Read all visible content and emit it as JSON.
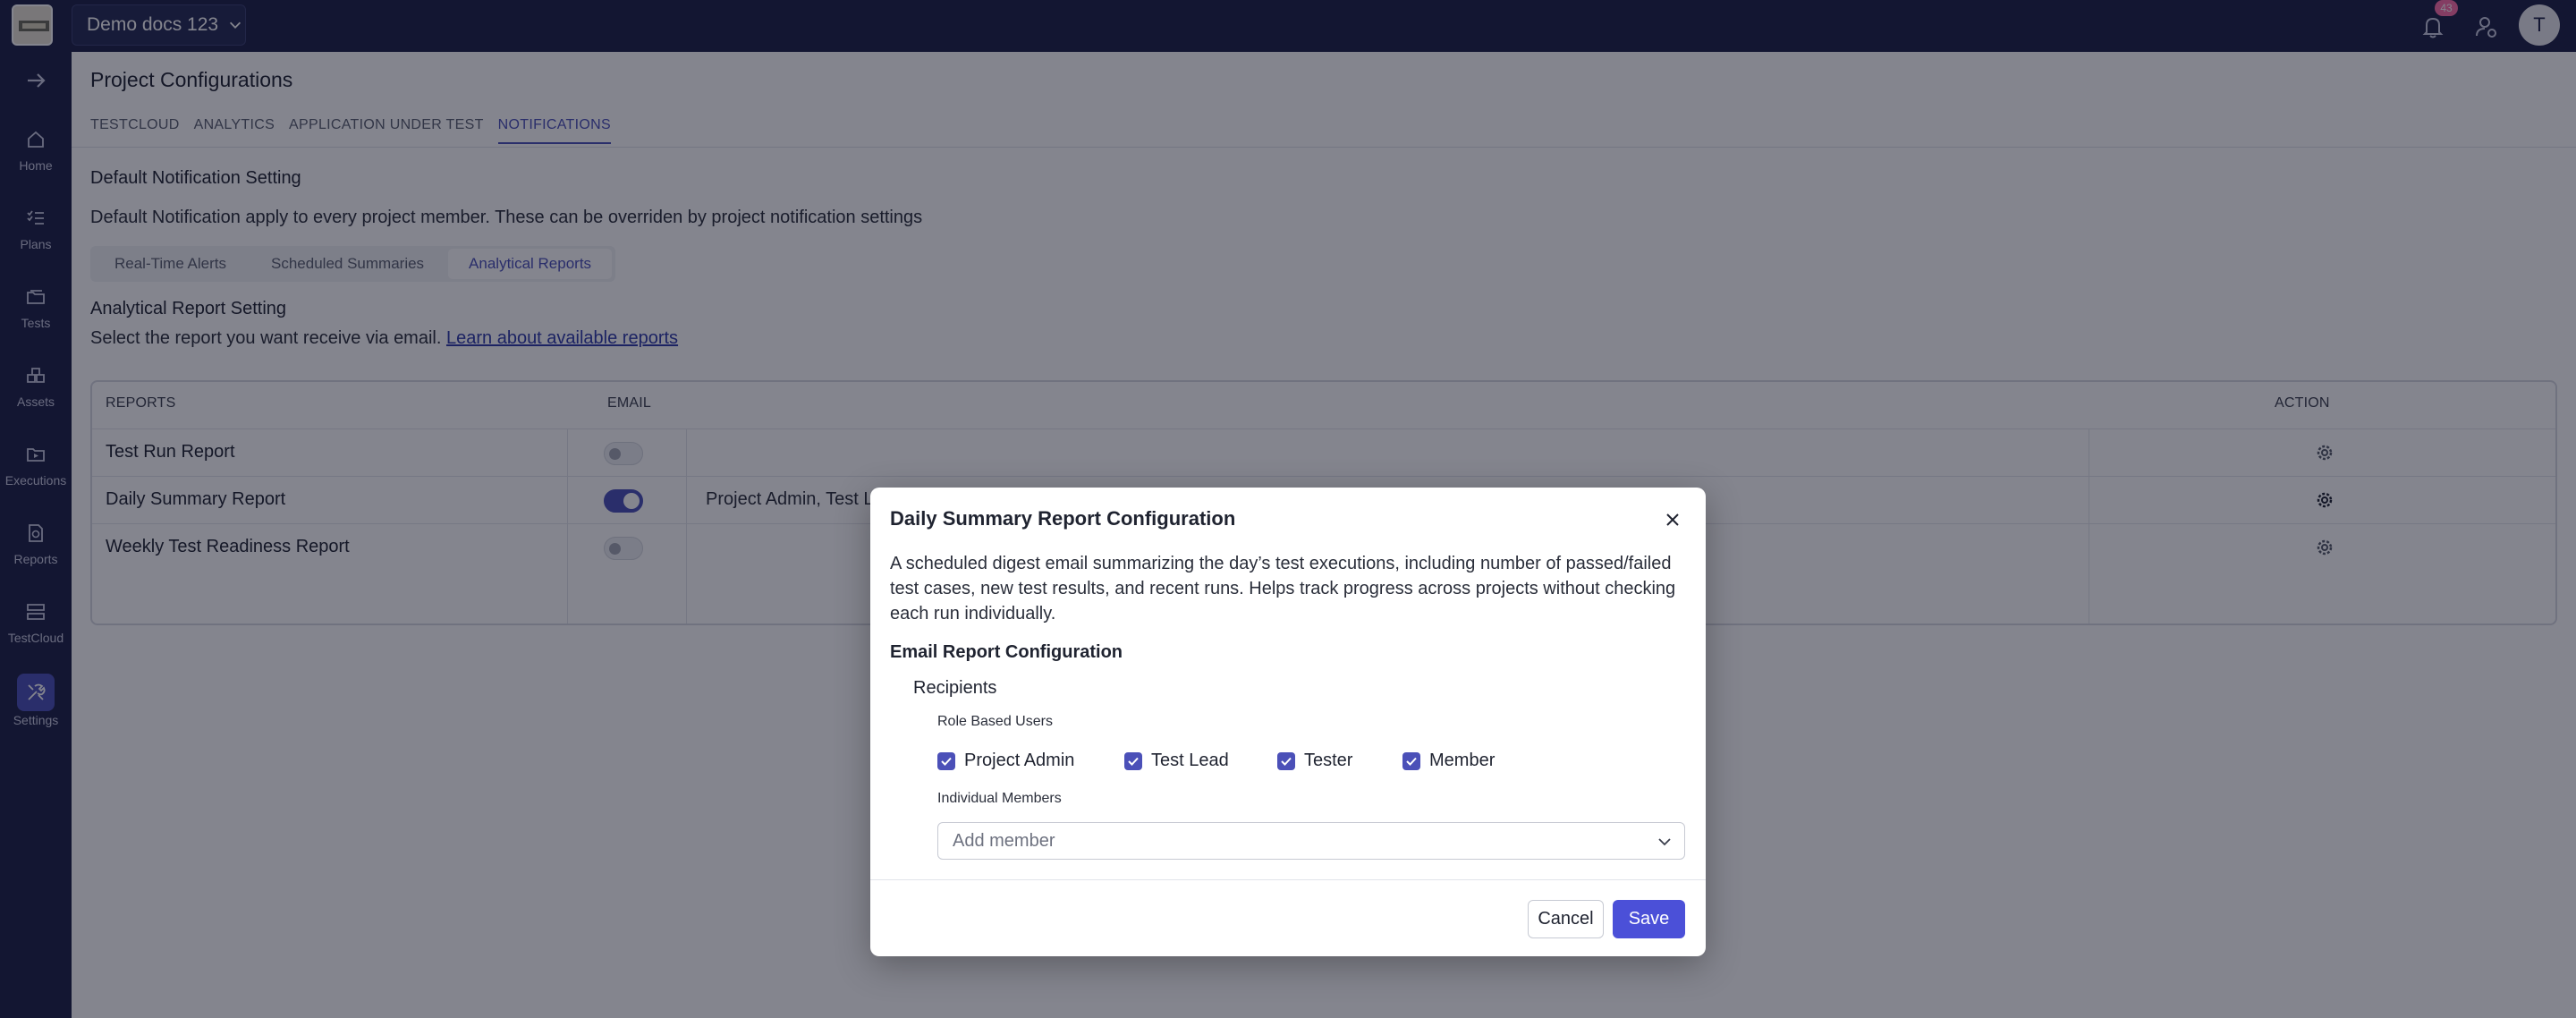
{
  "header": {
    "project_name": "Demo docs 123",
    "notification_count": "43",
    "avatar_initial": "T"
  },
  "sidebar": {
    "items": [
      {
        "label": "Home",
        "icon": "home-icon"
      },
      {
        "label": "Plans",
        "icon": "plans-icon"
      },
      {
        "label": "Tests",
        "icon": "tests-icon"
      },
      {
        "label": "Assets",
        "icon": "assets-icon"
      },
      {
        "label": "Executions",
        "icon": "executions-icon"
      },
      {
        "label": "Reports",
        "icon": "reports-icon"
      },
      {
        "label": "TestCloud",
        "icon": "testcloud-icon"
      },
      {
        "label": "Settings",
        "icon": "settings-icon",
        "active": true
      }
    ]
  },
  "page": {
    "title": "Project Configurations",
    "tabs": [
      "TESTCLOUD",
      "ANALYTICS",
      "APPLICATION UNDER TEST",
      "NOTIFICATIONS"
    ],
    "active_tab": "NOTIFICATIONS",
    "section_title": "Default Notification Setting",
    "section_desc": "Default Notification apply to every project member. These can be overriden by project notification settings",
    "subtabs": [
      "Real-Time Alerts",
      "Scheduled Summaries",
      "Analytical Reports"
    ],
    "active_subtab": "Analytical Reports",
    "report_title": "Analytical Report Setting",
    "report_desc": "Select the report you want receive via email.",
    "report_link": "Learn about available reports"
  },
  "table": {
    "headers": {
      "reports": "REPORTS",
      "email": "EMAIL",
      "action": "ACTION"
    },
    "rows": [
      {
        "name": "Test Run Report",
        "email_enabled": false,
        "recipients": ""
      },
      {
        "name": "Daily Summary Report",
        "email_enabled": true,
        "recipients": "Project Admin, Test L"
      },
      {
        "name": "Weekly Test Readiness Report",
        "email_enabled": false,
        "recipients": ""
      }
    ]
  },
  "modal": {
    "title": "Daily Summary Report Configuration",
    "description": "A scheduled digest email summarizing the day’s test executions, including number of passed/failed test cases, new test results, and recent runs. Helps track progress across projects without checking each run individually.",
    "email_config_title": "Email Report Configuration",
    "recipients_label": "Recipients",
    "role_based_label": "Role Based Users",
    "roles": [
      {
        "label": "Project Admin",
        "checked": true
      },
      {
        "label": "Test Lead",
        "checked": true
      },
      {
        "label": "Tester",
        "checked": true
      },
      {
        "label": "Member",
        "checked": true
      }
    ],
    "individual_label": "Individual Members",
    "member_placeholder": "Add member",
    "cancel_label": "Cancel",
    "save_label": "Save"
  },
  "colors": {
    "nav_bg": "#1d2147",
    "accent": "#4b50b8",
    "save_button": "#4b50d8",
    "badge": "#ff6ea8"
  }
}
